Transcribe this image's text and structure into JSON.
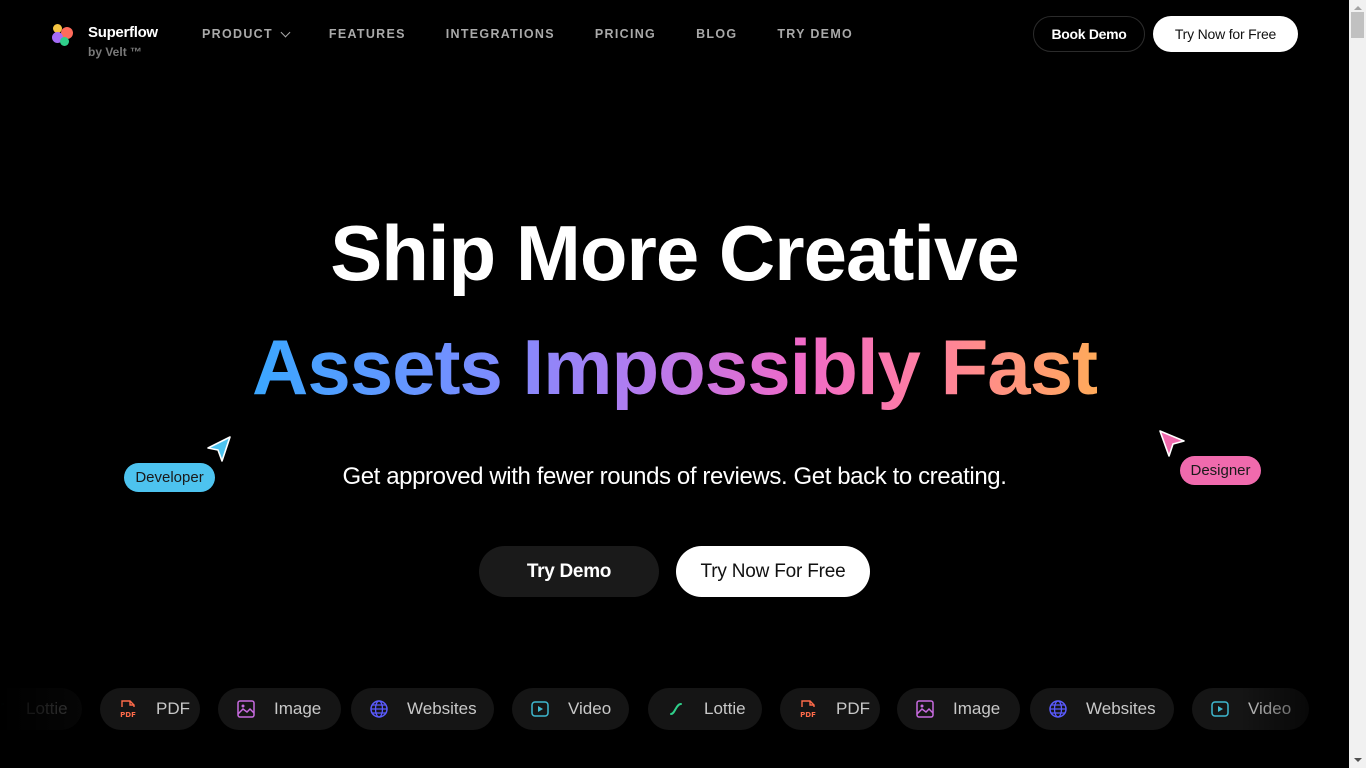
{
  "brand": {
    "name": "Superflow",
    "sub": "by Velt ™",
    "logo_colors": [
      "#f5c542",
      "#ff6b5b",
      "#a56cf7",
      "#2fcf8a"
    ]
  },
  "nav": {
    "items": [
      {
        "label": "PRODUCT",
        "has_dropdown": true
      },
      {
        "label": "FEATURES"
      },
      {
        "label": "INTEGRATIONS"
      },
      {
        "label": "PRICING"
      },
      {
        "label": "BLOG"
      },
      {
        "label": "TRY DEMO"
      }
    ],
    "book_demo": "Book Demo",
    "try_now": "Try Now for Free"
  },
  "hero": {
    "line1": "Ship More Creative",
    "line2": "Assets Impossibly Fast",
    "subtitle": "Get approved with fewer rounds of reviews. Get back to creating.",
    "try_demo": "Try Demo",
    "try_free": "Try Now For Free",
    "cursors": [
      {
        "label": "Developer",
        "color": "#4dc3ef"
      },
      {
        "label": "Designer",
        "color": "#f06aad"
      }
    ]
  },
  "asset_types": [
    {
      "label": "Lottie",
      "icon": "lottie-icon",
      "color": "#2fcf8a"
    },
    {
      "label": "PDF",
      "icon": "pdf-icon",
      "color": "#ff6b4a"
    },
    {
      "label": "Image",
      "icon": "image-icon",
      "color": "#c86be0"
    },
    {
      "label": "Websites",
      "icon": "globe-icon",
      "color": "#5b5bff"
    },
    {
      "label": "Video",
      "icon": "video-icon",
      "color": "#3fb8d0"
    },
    {
      "label": "Lottie",
      "icon": "lottie-icon",
      "color": "#2fcf8a"
    },
    {
      "label": "PDF",
      "icon": "pdf-icon",
      "color": "#ff6b4a"
    },
    {
      "label": "Image",
      "icon": "image-icon",
      "color": "#c86be0"
    },
    {
      "label": "Websites",
      "icon": "globe-icon",
      "color": "#5b5bff"
    },
    {
      "label": "Video",
      "icon": "video-icon",
      "color": "#3fb8d0"
    }
  ]
}
